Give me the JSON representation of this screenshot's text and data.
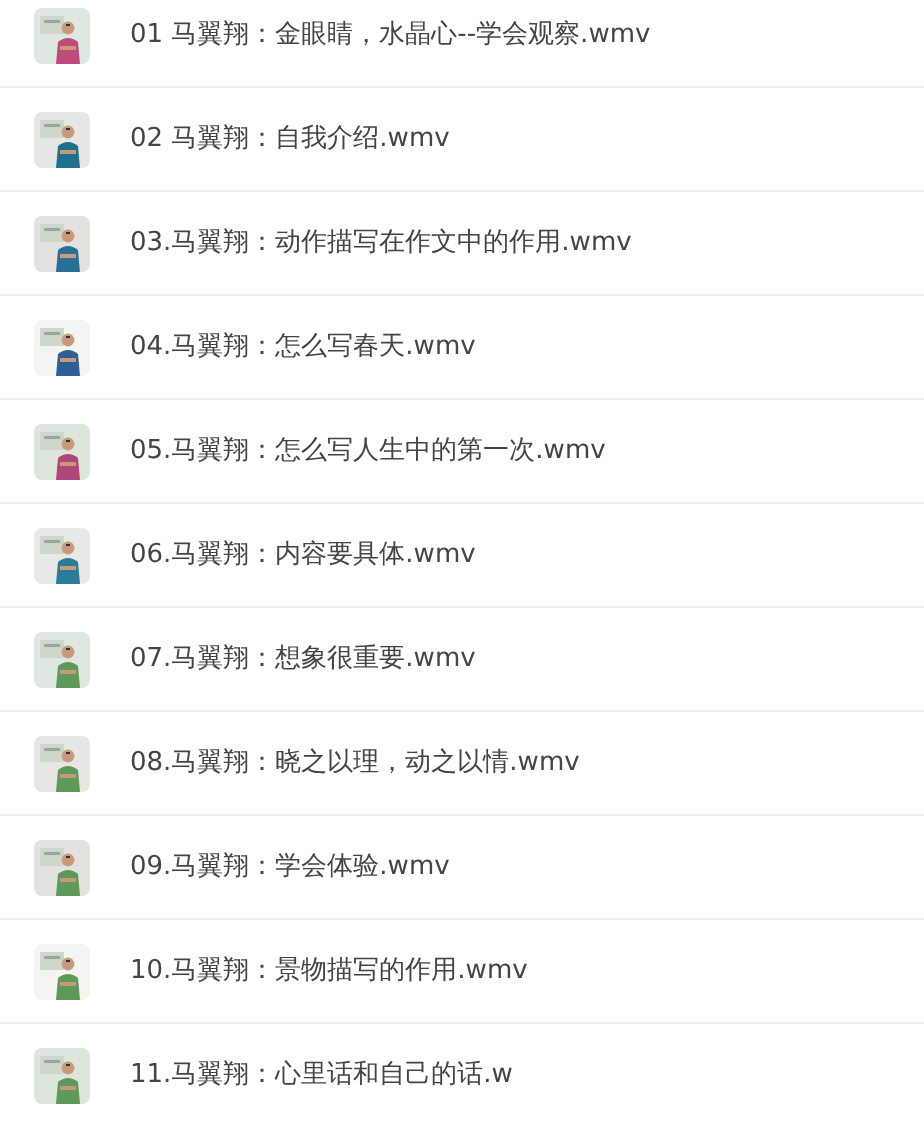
{
  "files": [
    {
      "title": "01 马翼翔：金眼睛，水晶心--学会观察.wmv"
    },
    {
      "title": "02 马翼翔：自我介绍.wmv"
    },
    {
      "title": "03.马翼翔：动作描写在作文中的作用.wmv"
    },
    {
      "title": "04.马翼翔：怎么写春天.wmv"
    },
    {
      "title": "05.马翼翔：怎么写人生中的第一次.wmv"
    },
    {
      "title": "06.马翼翔：内容要具体.wmv"
    },
    {
      "title": "07.马翼翔：想象很重要.wmv"
    },
    {
      "title": "08.马翼翔：晓之以理，动之以情.wmv"
    },
    {
      "title": "09.马翼翔：学会体验.wmv"
    },
    {
      "title": "10.马翼翔：景物描写的作用.wmv"
    },
    {
      "title": "11.马翼翔：心里话和自己的话.w"
    }
  ]
}
